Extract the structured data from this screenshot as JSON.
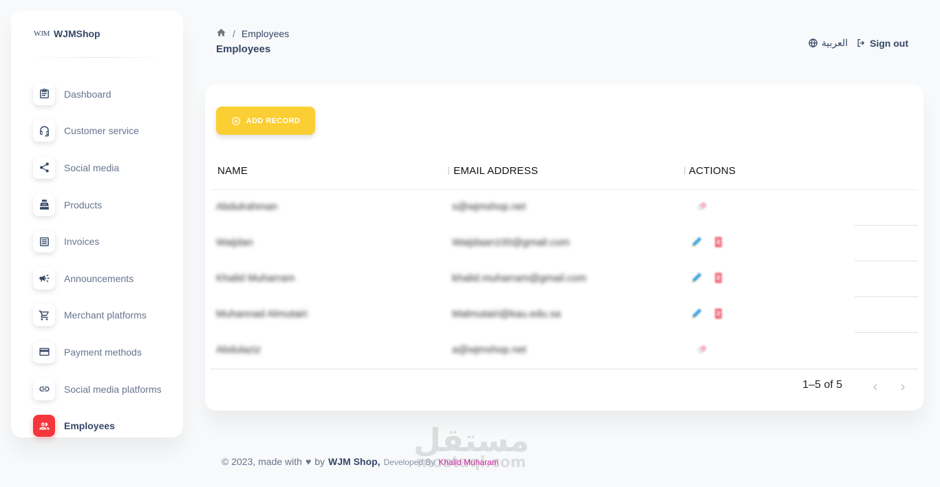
{
  "brand": {
    "logo_text": "WJM",
    "name": "WJMShop"
  },
  "sidebar": {
    "items": [
      {
        "label": "Dashboard",
        "icon": "clipboard-icon"
      },
      {
        "label": "Customer service",
        "icon": "headset-icon"
      },
      {
        "label": "Social media",
        "icon": "share-icon"
      },
      {
        "label": "Products",
        "icon": "register-icon"
      },
      {
        "label": "Invoices",
        "icon": "list-icon"
      },
      {
        "label": "Announcements",
        "icon": "megaphone-icon"
      },
      {
        "label": "Merchant platforms",
        "icon": "cart-icon"
      },
      {
        "label": "Payment methods",
        "icon": "credit-card-icon"
      },
      {
        "label": "Social media platforms",
        "icon": "link-icon"
      },
      {
        "label": "Employees",
        "icon": "users-icon",
        "active": true
      }
    ]
  },
  "header": {
    "breadcrumb": {
      "sep": "/",
      "current": "Employees"
    },
    "title": "Employees",
    "language_label": "العربية",
    "signout_label": "Sign out"
  },
  "table": {
    "add_label": "ADD RECORD",
    "columns": [
      "NAME",
      "EMAIL ADDRESS",
      "ACTIONS"
    ],
    "rows": [
      {
        "name": "Abdulrahman",
        "email": "s@wjmshop.net",
        "actions": [
          "remove"
        ]
      },
      {
        "name": "Waijdan",
        "email": "Waijdaan100@gmail.com",
        "actions": [
          "edit",
          "delete"
        ]
      },
      {
        "name": "Khalid Muharram",
        "email": "khalid.muharram@gmail.com",
        "actions": [
          "edit",
          "delete"
        ]
      },
      {
        "name": "Muhannad Almutairi",
        "email": "Malmutairi@kau.edu.sa",
        "actions": [
          "edit",
          "delete"
        ]
      },
      {
        "name": "Abdulaziz",
        "email": "a@wjmshop.net",
        "actions": [
          "remove"
        ]
      }
    ],
    "pagination": {
      "label": "1–5 of 5"
    }
  },
  "footer": {
    "prefix": "© 2023, made with",
    "by": "by",
    "company": "WJM Shop,",
    "developed_by": "Developed By",
    "author": "Khalid Muharam"
  },
  "watermark": {
    "arabic": "مستقل",
    "latin": "mostaql.com"
  },
  "colors": {
    "accent": "#f5363d",
    "add_button": "#fbcf33",
    "author_link": "#cb0c9f",
    "text": "#344767"
  }
}
